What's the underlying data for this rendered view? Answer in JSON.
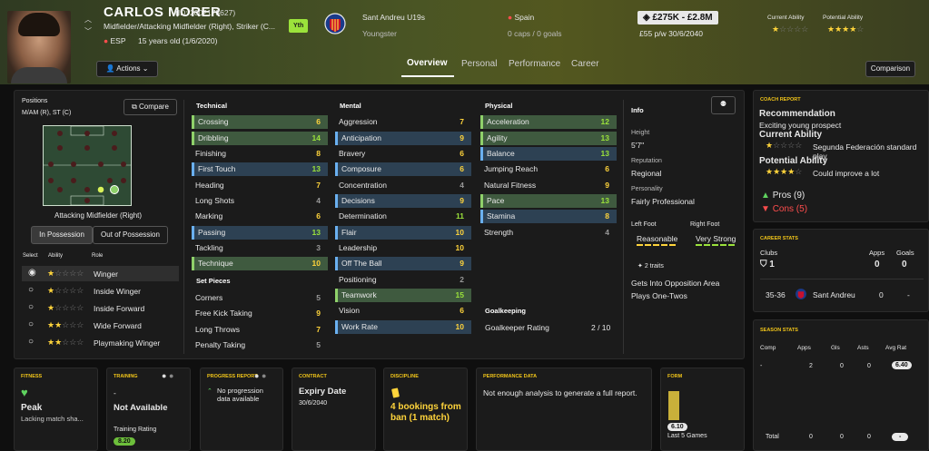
{
  "player": {
    "name": "CARLOS MORER",
    "id": "(ID: 2002173627)",
    "positions": "Midfielder/Attacking Midfielder (Right), Striker (C...",
    "nation": "ESP",
    "age": "15 years old (1/6/2020)",
    "youth_badge": "Yth",
    "club": "Sant Andreu U19s",
    "status": "Youngster",
    "nation_name": "Spain",
    "caps": "0 caps / 0 goals",
    "value": "£275K - £2.8M",
    "wage": "£55 p/w 30/6/2040",
    "current_ability_label": "Current Ability",
    "potential_ability_label": "Potential Ability",
    "ca_stars": "★",
    "ca_empty": "☆☆☆☆",
    "pa_stars": "★★★★",
    "pa_empty": "☆"
  },
  "header": {
    "actions": "Actions",
    "tabs": [
      "Overview",
      "Personal",
      "Performance",
      "Career"
    ],
    "comparison": "Comparison"
  },
  "positions_panel": {
    "title": "Positions",
    "positions_value": "M/AM (R), ST (C)",
    "compare": "Compare",
    "role_caption": "Attacking Midfielder (Right)",
    "in_possession": "In Possession",
    "out_possession": "Out of Possession",
    "col_select": "Select",
    "col_ability": "Ability",
    "col_role": "Role",
    "roles": [
      {
        "name": "Winger",
        "stars": "★",
        "empty": "☆☆☆☆"
      },
      {
        "name": "Inside Winger",
        "stars": "★",
        "empty": "☆☆☆☆"
      },
      {
        "name": "Inside Forward",
        "stars": "★",
        "empty": "☆☆☆☆"
      },
      {
        "name": "Wide Forward",
        "stars": "★★",
        "empty": "☆☆☆"
      },
      {
        "name": "Playmaking Winger",
        "stars": "★★",
        "empty": "☆☆☆"
      }
    ]
  },
  "attributes": {
    "technical_title": "Technical",
    "technical": [
      {
        "name": "Crossing",
        "value": "6"
      },
      {
        "name": "Dribbling",
        "value": "14"
      },
      {
        "name": "Finishing",
        "value": "8"
      },
      {
        "name": "First Touch",
        "value": "13"
      },
      {
        "name": "Heading",
        "value": "7"
      },
      {
        "name": "Long Shots",
        "value": "4"
      },
      {
        "name": "Marking",
        "value": "6"
      },
      {
        "name": "Passing",
        "value": "13"
      },
      {
        "name": "Tackling",
        "value": "3"
      },
      {
        "name": "Technique",
        "value": "10"
      }
    ],
    "set_pieces_title": "Set Pieces",
    "set_pieces": [
      {
        "name": "Corners",
        "value": "5"
      },
      {
        "name": "Free Kick Taking",
        "value": "9"
      },
      {
        "name": "Long Throws",
        "value": "7"
      },
      {
        "name": "Penalty Taking",
        "value": "5"
      }
    ],
    "mental_title": "Mental",
    "mental": [
      {
        "name": "Aggression",
        "value": "7"
      },
      {
        "name": "Anticipation",
        "value": "9"
      },
      {
        "name": "Bravery",
        "value": "6"
      },
      {
        "name": "Composure",
        "value": "6"
      },
      {
        "name": "Concentration",
        "value": "4"
      },
      {
        "name": "Decisions",
        "value": "9"
      },
      {
        "name": "Determination",
        "value": "11"
      },
      {
        "name": "Flair",
        "value": "10"
      },
      {
        "name": "Leadership",
        "value": "10"
      },
      {
        "name": "Off The Ball",
        "value": "9"
      },
      {
        "name": "Positioning",
        "value": "2"
      },
      {
        "name": "Teamwork",
        "value": "15"
      },
      {
        "name": "Vision",
        "value": "6"
      },
      {
        "name": "Work Rate",
        "value": "10"
      }
    ],
    "physical_title": "Physical",
    "physical": [
      {
        "name": "Acceleration",
        "value": "12"
      },
      {
        "name": "Agility",
        "value": "13"
      },
      {
        "name": "Balance",
        "value": "13"
      },
      {
        "name": "Jumping Reach",
        "value": "6"
      },
      {
        "name": "Natural Fitness",
        "value": "9"
      },
      {
        "name": "Pace",
        "value": "13"
      },
      {
        "name": "Stamina",
        "value": "8"
      },
      {
        "name": "Strength",
        "value": "4"
      }
    ],
    "goalkeeping_title": "Goalkeeping",
    "gk_rating_label": "Goalkeeper Rating",
    "gk_rating_value": "2 / 10"
  },
  "info": {
    "title": "Info",
    "height_label": "Height",
    "height": "5'7\"",
    "reputation_label": "Reputation",
    "reputation": "Regional",
    "personality_label": "Personality",
    "personality": "Fairly Professional",
    "left_foot_label": "Left Foot",
    "left_foot": "Reasonable",
    "right_foot_label": "Right Foot",
    "right_foot": "Very Strong",
    "traits_count": "2 traits",
    "traits": [
      "Gets Into Opposition Area",
      "Plays One-Twos"
    ]
  },
  "coach_report": {
    "title": "COACH REPORT",
    "recommendation_label": "Recommendation",
    "recommendation": "Exciting young prospect",
    "ca_label": "Current Ability",
    "ca_text": "Segunda Federación standard play",
    "pa_label": "Potential Ability",
    "pa_text": "Could improve a lot",
    "pros": "Pros (9)",
    "cons": "Cons (5)"
  },
  "career_stats": {
    "title": "CAREER STATS",
    "clubs_label": "Clubs",
    "apps_label": "Apps",
    "goals_label": "Goals",
    "clubs_count": "1",
    "apps_total": "0",
    "goals_total": "0",
    "row_season": "35-36",
    "row_club": "Sant Andreu",
    "row_apps": "0",
    "row_goals": "-"
  },
  "season_stats": {
    "title": "SEASON STATS",
    "headers": [
      "Comp",
      "Apps",
      "Gls",
      "Asts",
      "Avg Rat"
    ],
    "row": [
      "-",
      "2",
      "0",
      "0",
      "6.40"
    ],
    "total": [
      "Total",
      "0",
      "0",
      "0",
      "-"
    ]
  },
  "cards": {
    "fitness_title": "FITNESS",
    "fitness_value": "Peak",
    "fitness_sub": "Lacking match sha...",
    "training_title": "TRAINING",
    "training_dash": "-",
    "training_value": "Not Available",
    "training_rating_label": "Training Rating",
    "training_rating": "8.20",
    "progress_title": "PROGRESS REPORT",
    "progress_text": "No progression data available",
    "contract_title": "CONTRACT",
    "contract_value": "Expiry Date",
    "contract_date": "30/6/2040",
    "discipline_title": "DISCIPLINE",
    "discipline_text": "4 bookings from ban (1 match)",
    "performance_title": "PERFORMANCE DATA",
    "performance_text": "Not enough analysis to generate a full report.",
    "form_title": "FORM",
    "form_value": "6.10",
    "form_sub": "Last 5 Games"
  }
}
